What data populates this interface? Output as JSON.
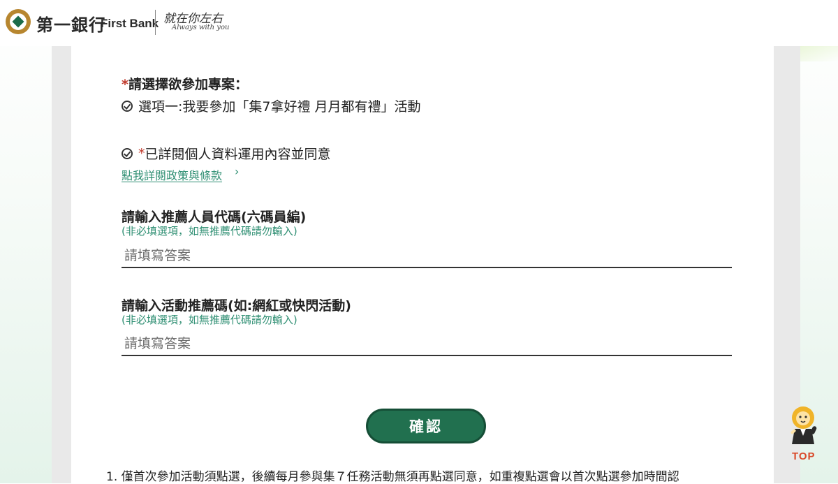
{
  "header": {
    "brand_cn": "第一銀行",
    "brand_en": "First Bank",
    "slogan_cn": "就在你左右",
    "slogan_en": "Always with you"
  },
  "form": {
    "project_question": {
      "required_mark": "*",
      "label": "請選擇欲參加專案：",
      "option_label": "選項一:我要參加「集7拿好禮 月月都有禮」活動",
      "checked": true
    },
    "consent": {
      "required_mark": "*",
      "label": "已詳閱個人資料運用內容並同意",
      "checked": true,
      "policy_link": "點我詳閱政策與條款",
      "policy_arrow": "›"
    },
    "referrer_code": {
      "label": "請輸入推薦人員代碼(六碼員編)",
      "hint": "(非必填選項，如無推薦代碼請勿輸入)",
      "placeholder": "請填寫答案",
      "value": ""
    },
    "promo_code": {
      "label": "請輸入活動推薦碼(如:網紅或快閃活動)",
      "hint": "(非必填選項，如無推薦代碼請勿輸入)",
      "placeholder": "請填寫答案",
      "value": ""
    },
    "confirm_label": "確認"
  },
  "notes": [
    "1. 僅首次參加活動須點選，後續每月參與集７任務活動無須再點選同意，如重複點選會以首次點選參加時間認"
  ],
  "back_to_top": {
    "label": "TOP",
    "icon": "lion-mascot-icon"
  },
  "colors": {
    "brand_green": "#21704f",
    "link_green": "#2f8f73",
    "required_red": "#c0392b",
    "top_orange": "#d94a2b",
    "logo_gold": "#b7862f"
  }
}
